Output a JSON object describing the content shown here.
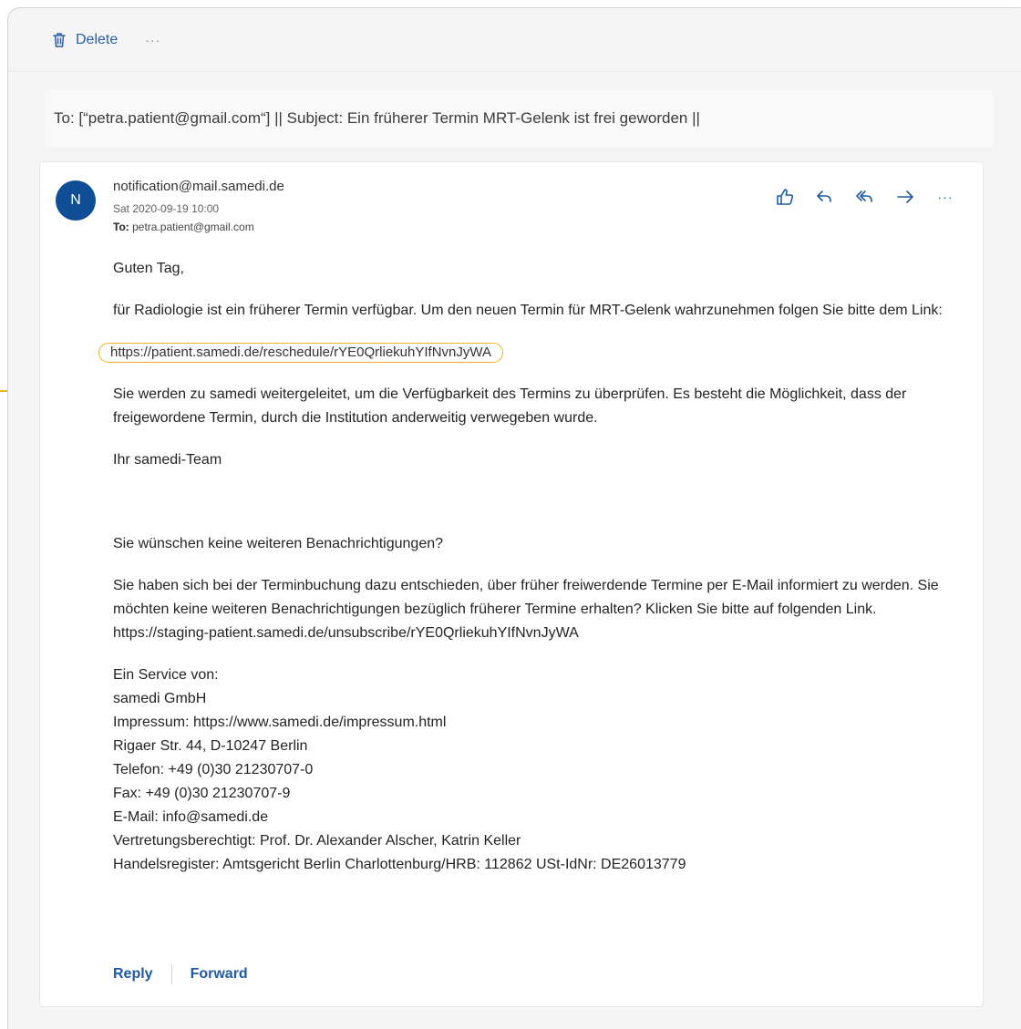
{
  "toolbar": {
    "delete_label": "Delete",
    "more_label": "···"
  },
  "subject_line": "To: [“petra.patient@gmail.com“] || Subject: Ein früherer  Termin MRT-Gelenk ist frei geworden ||",
  "message": {
    "avatar_initial": "N",
    "sender": "notification@mail.samedi.de",
    "date": "Sat 2020-09-19 10:00",
    "to_label": "To:",
    "to_value": "petra.patient@gmail.com",
    "actions": [
      "like-icon",
      "reply-icon",
      "reply-all-icon",
      "forward-icon",
      "more-icon"
    ],
    "more_label": "···"
  },
  "body": {
    "greeting": "Guten Tag,",
    "para1": "für Radiologie ist ein früherer Termin verfügbar. Um den neuen Termin für MRT-Gelenk wahrzunehmen folgen Sie bitte dem Link:",
    "link": "https://patient.samedi.de/reschedule/rYE0QrliekuhYIfNvnJyWA",
    "para2": "Sie werden zu samedi weitergeleitet, um die Verfügbarkeit des Termins zu überprüfen. Es besteht die Möglichkeit, dass der freigewordene Termin, durch die Institution anderweitig verwegeben wurde.",
    "signoff": "Ihr samedi-Team",
    "question": "Sie wünschen keine weiteren Benachrichtigungen?",
    "para3": "Sie haben sich bei der Terminbuchung dazu entschieden, über früher freiwerdende Termine per E-Mail informiert zu werden. Sie möchten keine weiteren Benachrichtigungen bezüglich früherer Termine erhalten? Klicken Sie bitte auf folgenden Link. https://staging-patient.samedi.de/unsubscribe/rYE0QrliekuhYIfNvnJyWA",
    "footer_lines": [
      "Ein Service von:",
      "samedi GmbH",
      "Impressum: https://www.samedi.de/impressum.html",
      "Rigaer Str. 44, D-10247 Berlin",
      "Telefon: +49 (0)30 21230707-0",
      "Fax: +49 (0)30 21230707-9",
      "E-Mail: info@samedi.de",
      "Vertretungsberechtigt: Prof. Dr. Alexander Alscher, Katrin Keller",
      "Handelsregister: Amtsgericht Berlin Charlottenburg/HRB: 112862 USt-IdNr: DE26013779"
    ]
  },
  "footer_actions": {
    "reply_label": "Reply",
    "forward_label": "Forward"
  },
  "colors": {
    "accent": "#1f5aa6",
    "avatar_bg": "#0f4e95",
    "highlight": "#f1b326"
  }
}
